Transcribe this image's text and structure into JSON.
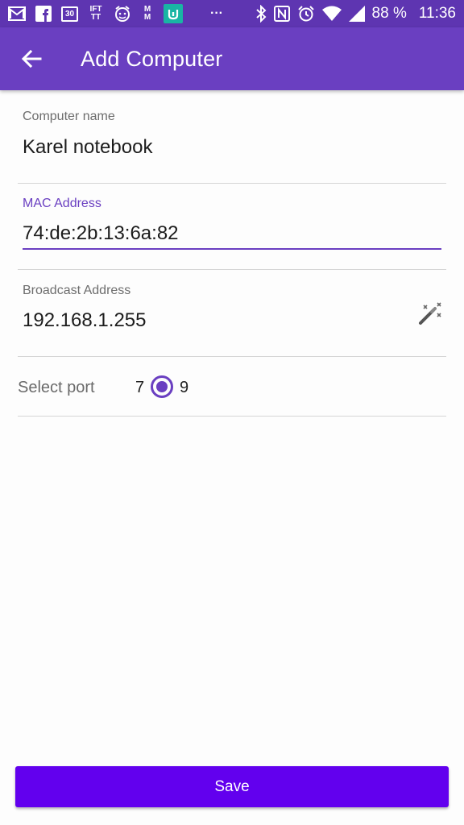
{
  "status_bar": {
    "left_icons": [
      "gmail-icon",
      "facebook-icon",
      "calendar-icon",
      "ifttt-icon",
      "alarm-app-icon",
      "m-app-icon",
      "mi-app-icon",
      "more-notifications-icon"
    ],
    "calendar_day": "30",
    "ifttt_label": "IFT TT",
    "m_label": "M M",
    "more": "···",
    "battery": "88 %",
    "time": "11:36"
  },
  "app_bar": {
    "title": "Add Computer"
  },
  "form": {
    "computer_name": {
      "label": "Computer name",
      "value": "Karel notebook"
    },
    "mac_address": {
      "label": "MAC Address",
      "value": "74:de:2b:13:6a:82"
    },
    "broadcast_address": {
      "label": "Broadcast Address",
      "value": "192.168.1.255"
    },
    "port": {
      "label": "Select port",
      "option_7": "7",
      "option_9": "9",
      "selected": "9"
    }
  },
  "save_label": "Save",
  "colors": {
    "status_bar": "#5e35b1",
    "app_bar": "#6a3fc1",
    "accent": "#6a3fc1",
    "button": "#6200ee"
  }
}
